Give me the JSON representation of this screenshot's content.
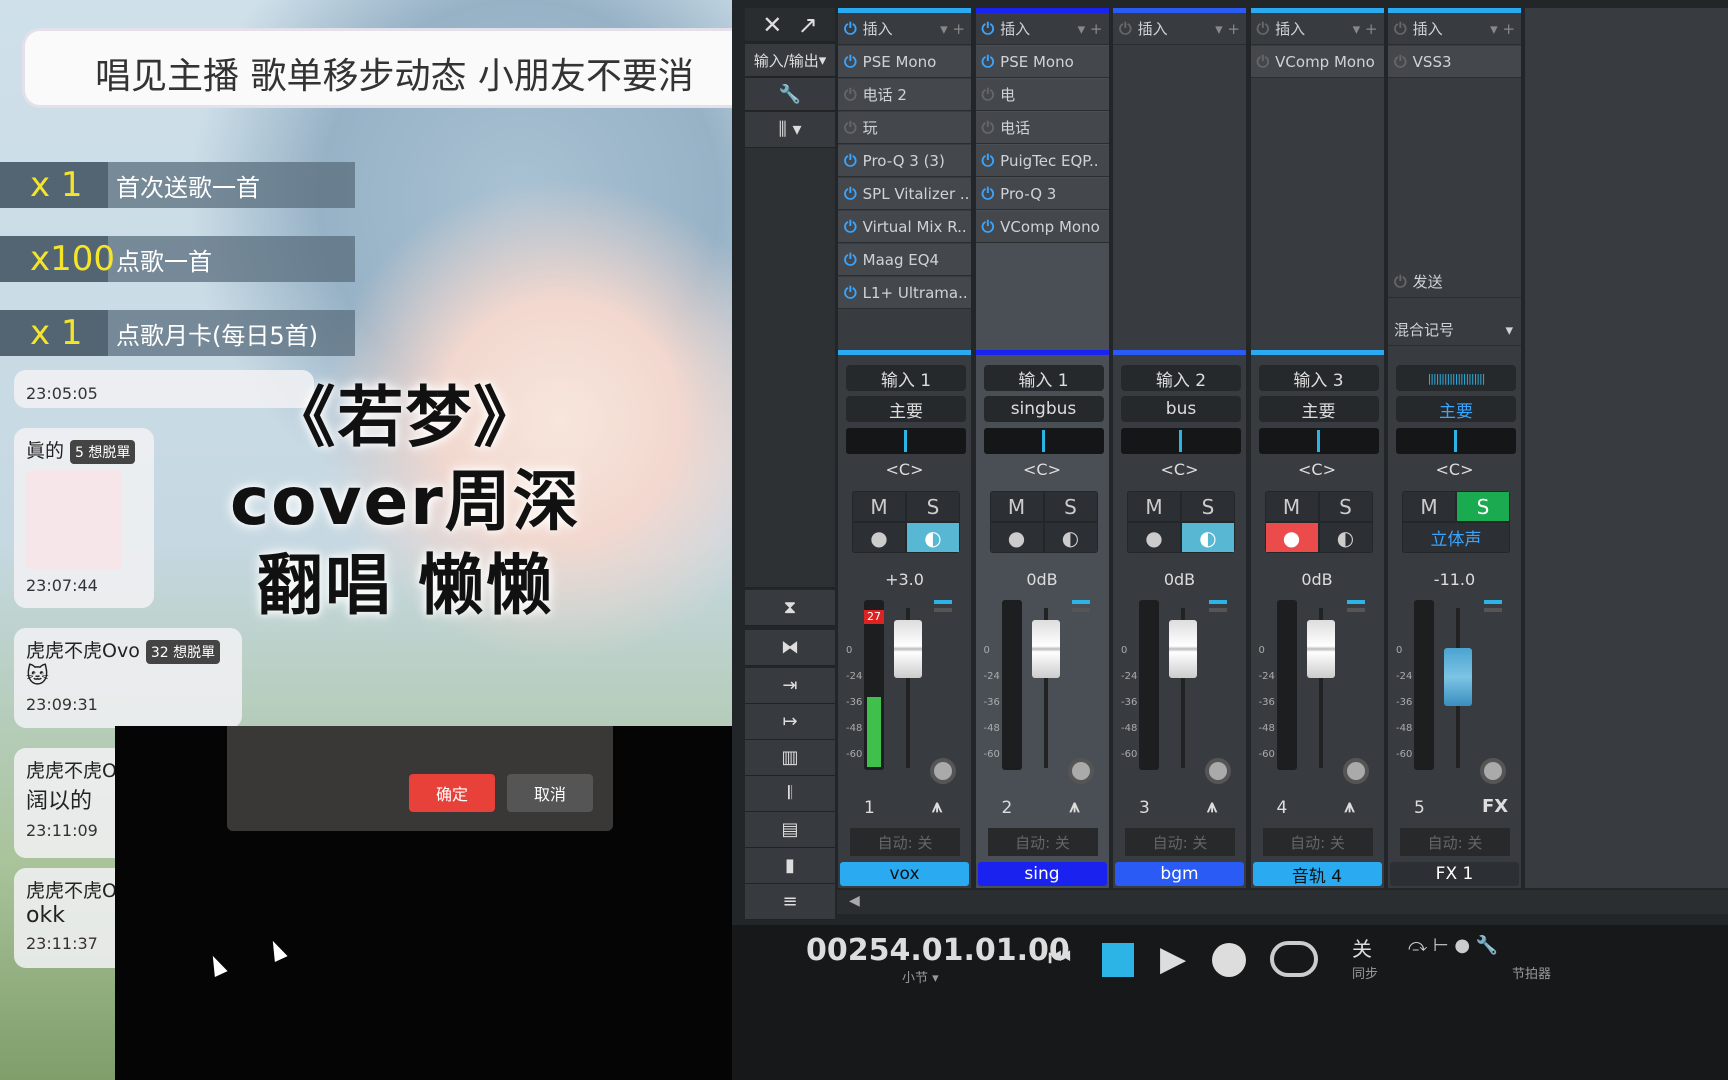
{
  "stream": {
    "banner": "唱见主播 歌单移步动态 小朋友不要消",
    "gifts": [
      {
        "count": "x 1",
        "label": "首次送歌一首"
      },
      {
        "count": "x100",
        "label": "点歌一首"
      },
      {
        "count": "x 1",
        "label": "点歌月卡(每日5首)"
      }
    ],
    "chat": [
      {
        "name": "",
        "badge": "",
        "msg": "",
        "time": "23:05:05"
      },
      {
        "name": "眞的",
        "badge": "5 想脱單",
        "msg": "",
        "time": "23:07:44"
      },
      {
        "name": "虎虎不虎Ovo",
        "badge": "32 想脱單",
        "msg": "🐱",
        "time": "23:09:31"
      },
      {
        "name": "虎虎不虎O",
        "badge": "",
        "msg": "阔以的",
        "time": "23:11:09"
      },
      {
        "name": "虎虎不虎O",
        "badge": "",
        "msg": "okk",
        "time": "23:11:37"
      }
    ],
    "title_lines": [
      "《若梦》",
      "cover周深",
      "翻唱  懒懒"
    ],
    "dialog": {
      "confirm": "确定",
      "cancel": "取消",
      "confirm_color": "#e8413a"
    }
  },
  "mixer": {
    "toolbar": {
      "io_label": "输入/输出"
    },
    "insert_label": "插入",
    "send_label": "发送",
    "mix_label": "混合记号",
    "channels": [
      {
        "num": "1",
        "name": "vox",
        "color": "#2aaaf0",
        "plugins": [
          [
            "PSE Mono",
            1
          ],
          [
            "电话 2",
            0
          ],
          [
            "玩",
            0
          ],
          [
            "Pro-Q 3 (3)",
            1
          ],
          [
            "SPL Vitalizer ..",
            1
          ],
          [
            "Virtual Mix R..",
            1
          ],
          [
            "Maag EQ4",
            1
          ],
          [
            "L1+ Ultrama..",
            1
          ]
        ],
        "input": "输入 1",
        "output": "主要",
        "pan": "<C>",
        "volume": "+3.0",
        "meter": "27",
        "solo": false,
        "mon": true,
        "rec": false,
        "auto": "自动: 关",
        "type": "wave"
      },
      {
        "num": "2",
        "name": "sing",
        "color": "#1a22f0",
        "plugins": [
          [
            "PSE Mono",
            1
          ],
          [
            "电",
            0
          ],
          [
            "电话",
            0
          ],
          [
            "PuigTec EQP..",
            1
          ],
          [
            "Pro-Q 3",
            1
          ],
          [
            "VComp Mono",
            1
          ]
        ],
        "input": "输入 1",
        "output": "singbus",
        "pan": "<C>",
        "volume": "0dB",
        "solo": false,
        "mon": false,
        "rec": false,
        "auto": "自动: 关",
        "type": "wave",
        "selected": true
      },
      {
        "num": "3",
        "name": "bgm",
        "color": "#2a5cf5",
        "plugins": [],
        "input": "输入 2",
        "output": "bus",
        "pan": "<C>",
        "volume": "0dB",
        "solo": false,
        "mon": true,
        "rec": false,
        "auto": "自动: 关",
        "type": "wave"
      },
      {
        "num": "4",
        "name": "音轨 4",
        "color": "#2aaaf0",
        "plugins": [
          [
            "VComp Mono",
            0
          ]
        ],
        "input": "输入 3",
        "output": "主要",
        "pan": "<C>",
        "volume": "0dB",
        "solo": false,
        "mon": false,
        "rec": true,
        "auto": "自动: 关",
        "type": "wave"
      },
      {
        "num": "5",
        "name": "FX 1",
        "color": "#2c2f33",
        "plugins": [
          [
            "VSS3",
            0
          ]
        ],
        "input": "",
        "output": "主要",
        "pan": "<C>",
        "volume": "-11.0",
        "solo": true,
        "stereo": "立体声",
        "auto": "自动: 关",
        "type": "FX",
        "fx": true
      }
    ],
    "transport": {
      "position": "00254.01.01.00",
      "unit": "小节",
      "sync_top": "关",
      "sync_bottom": "同步",
      "metronome": "节拍器"
    }
  }
}
